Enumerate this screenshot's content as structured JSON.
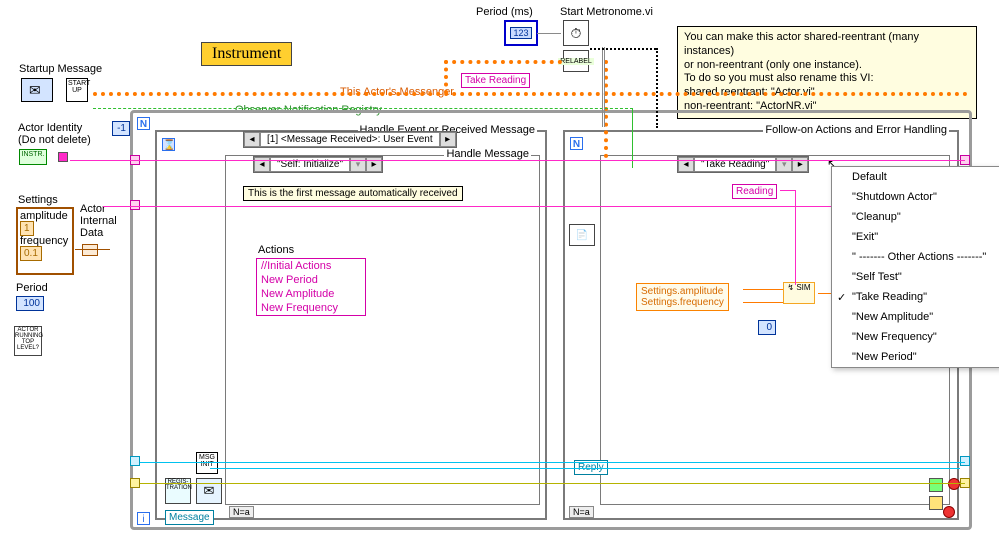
{
  "top": {
    "period_lbl": "Period (ms)",
    "period_val": "123",
    "metronome_lbl": "Start Metronome.vi",
    "take_reading": "Take Reading",
    "messenger_lbl": "This Actor's Messenger",
    "registry_lbl": "Observer-Notification Registry",
    "instrument_tag": "Instrument"
  },
  "left": {
    "startup_lbl": "Startup Message",
    "startup_icon": "START\nUP",
    "identity_lbl": "Actor Identity\n(Do not delete)",
    "instr_icon": "INSTR.",
    "settings_lbl": "Settings",
    "amplitude_lbl": "amplitude",
    "amplitude_val": "1",
    "frequency_lbl": "frequency",
    "frequency_val": "0.1",
    "period_lbl": "Period",
    "period_val": "100",
    "actor_run_lbl": "ACTOR\nRUNNING\nTOP\nLEVEL?",
    "internal_lbl": "Actor\nInternal\nData",
    "neg1": "-1"
  },
  "main_loop": {
    "event_title": "Handle Event or Received Message",
    "event_case": "[1]  <Message Received>: User Event",
    "msg_title": "Handle Message",
    "msg_case": "\"Self: Initialize\"",
    "first_msg": "This is the first message automatically received",
    "actions_hdr": "Actions",
    "actions": [
      "//Initial Actions",
      "New Period",
      "New Amplitude",
      "New Frequency"
    ],
    "reg_lbl": "REGIS-\nTRATION",
    "message_lbl": "Message",
    "followon_title": "Follow-on Actions and Error Handling",
    "followon_case": "\"Take Reading\"",
    "reading": "Reading",
    "settings_amp": "Settings.amplitude",
    "settings_freq": "Settings.frequency",
    "zero": "0",
    "reply_lbl": "Reply",
    "msginit": "MSG\nINIT",
    "n": "N",
    "i": "i",
    "na": "N=a"
  },
  "comment": {
    "l1": "You can make this actor shared-reentrant (many instances)",
    "l2": "or non-reentrant (only one instance).",
    "l3": "To do so you must also rename this VI:",
    "l4": "    shared reentrant: \"Actor.vi\"",
    "l5": "    non-reentrant: \"ActorNR.vi\""
  },
  "menu": {
    "items": [
      "Default",
      "\"Shutdown Actor\"",
      "\"Cleanup\"",
      "\"Exit\"",
      "\" ------- Other Actions -------\"",
      "\"Self Test\"",
      "\"Take Reading\"",
      "\"New Amplitude\"",
      "\"New Frequency\"",
      "\"New Period\""
    ],
    "checked": "\"Take Reading\""
  }
}
